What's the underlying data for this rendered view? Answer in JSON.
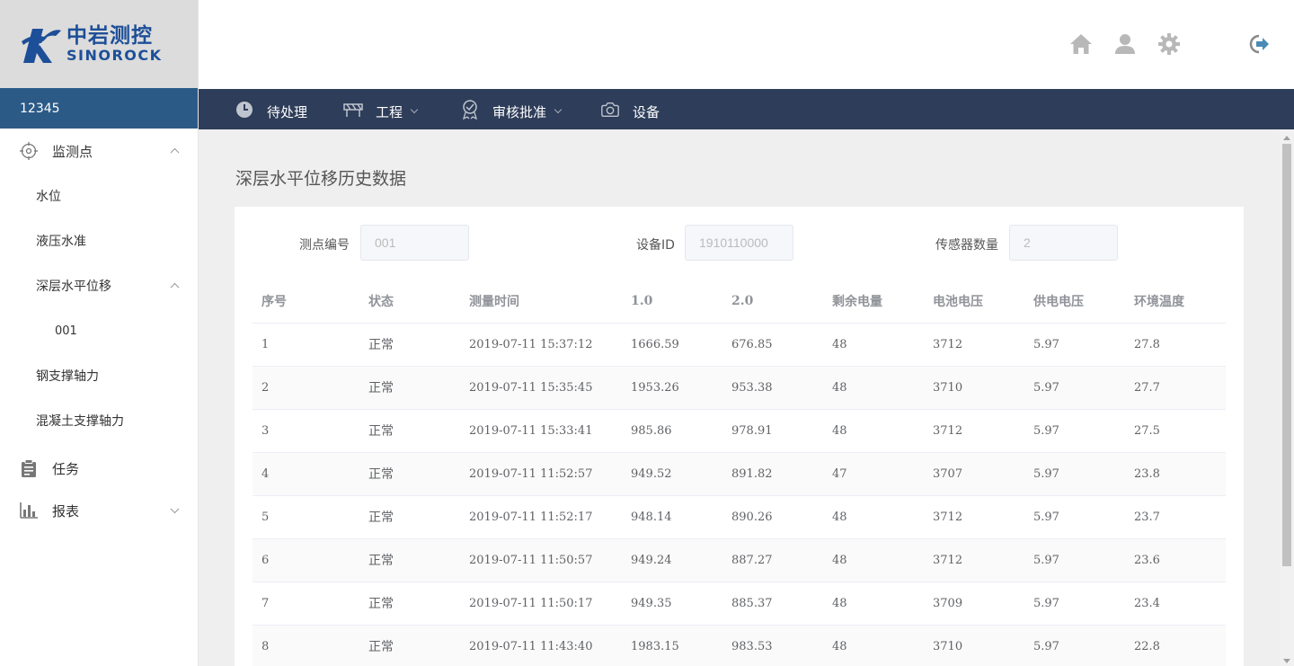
{
  "brand": {
    "name_cn": "中岩测控",
    "name_en": "SINOROCK"
  },
  "user": {
    "id": "12345"
  },
  "header_icons": [
    "home-icon",
    "user-icon",
    "gear-icon",
    "logout-icon"
  ],
  "colors": {
    "nav_bg": "#2e3d59",
    "user_bar": "#2c5a87",
    "brand": "#1d4f98"
  },
  "sidebar": {
    "monitor": {
      "label": "监测点",
      "items": [
        "水位",
        "液压水准"
      ],
      "deep": {
        "label": "深层水平位移",
        "children": [
          "001"
        ]
      },
      "more": [
        "钢支撑轴力",
        "混凝土支撑轴力"
      ]
    },
    "task": {
      "label": "任务"
    },
    "report": {
      "label": "报表"
    }
  },
  "nav": {
    "pending": "待处理",
    "project": "工程",
    "approval": "审核批准",
    "device": "设备"
  },
  "page": {
    "title": "深层水平位移历史数据",
    "fields": {
      "point_label": "测点编号",
      "point_value": "001",
      "device_label": "设备ID",
      "device_value": "1910110000",
      "sensor_label": "传感器数量",
      "sensor_value": "2"
    }
  },
  "table": {
    "headers": [
      "序号",
      "状态",
      "测量时间",
      "1.0",
      "2.0",
      "剩余电量",
      "电池电压",
      "供电电压",
      "环境温度"
    ],
    "rows": [
      [
        "1",
        "正常",
        "2019-07-11 15:37:12",
        "1666.59",
        "676.85",
        "48",
        "3712",
        "5.97",
        "27.8"
      ],
      [
        "2",
        "正常",
        "2019-07-11 15:35:45",
        "1953.26",
        "953.38",
        "48",
        "3710",
        "5.97",
        "27.7"
      ],
      [
        "3",
        "正常",
        "2019-07-11 15:33:41",
        "985.86",
        "978.91",
        "48",
        "3712",
        "5.97",
        "27.5"
      ],
      [
        "4",
        "正常",
        "2019-07-11 11:52:57",
        "949.52",
        "891.82",
        "47",
        "3707",
        "5.97",
        "23.8"
      ],
      [
        "5",
        "正常",
        "2019-07-11 11:52:17",
        "948.14",
        "890.26",
        "48",
        "3712",
        "5.97",
        "23.7"
      ],
      [
        "6",
        "正常",
        "2019-07-11 11:50:57",
        "949.24",
        "887.27",
        "48",
        "3712",
        "5.97",
        "23.6"
      ],
      [
        "7",
        "正常",
        "2019-07-11 11:50:17",
        "949.35",
        "885.37",
        "48",
        "3709",
        "5.97",
        "23.4"
      ],
      [
        "8",
        "正常",
        "2019-07-11 11:43:40",
        "1983.15",
        "983.53",
        "48",
        "3710",
        "5.97",
        "22.8"
      ]
    ]
  }
}
